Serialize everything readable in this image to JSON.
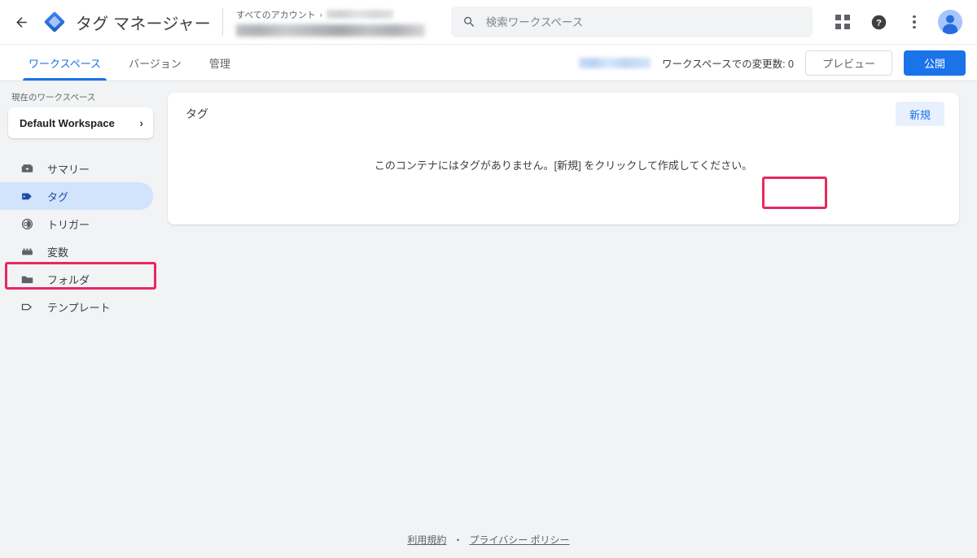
{
  "topbar": {
    "back_icon": "back-arrow-icon",
    "logo_icon": "tag-manager-logo-icon",
    "title": "タグ マネージャー",
    "breadcrumb": {
      "all_accounts": "すべてのアカウント",
      "separator": "›",
      "account_name_redacted": "",
      "container_name_redacted": ""
    },
    "search": {
      "icon": "search-icon",
      "placeholder": "検索ワークスペース",
      "value": ""
    },
    "apps_icon": "apps-grid-icon",
    "help_icon": "help-circle-icon",
    "more_icon": "more-vertical-icon",
    "avatar_icon": "account-avatar-icon"
  },
  "tabbar": {
    "tabs": [
      {
        "label": "ワークスペース",
        "active": true
      },
      {
        "label": "バージョン",
        "active": false
      },
      {
        "label": "管理",
        "active": false
      }
    ],
    "container_badge_redacted": "",
    "changes_text": "ワークスペースでの変更数: 0",
    "preview_label": "プレビュー",
    "publish_label": "公開"
  },
  "sidebar": {
    "workspace_label": "現在のワークスペース",
    "workspace_name": "Default Workspace",
    "workspace_chevron": "›",
    "items": [
      {
        "label": "サマリー",
        "icon": "summary-icon",
        "active": false
      },
      {
        "label": "タグ",
        "icon": "tag-icon",
        "active": true
      },
      {
        "label": "トリガー",
        "icon": "trigger-icon",
        "active": false
      },
      {
        "label": "変数",
        "icon": "variables-icon",
        "active": false
      },
      {
        "label": "フォルダ",
        "icon": "folder-icon",
        "active": false
      },
      {
        "label": "テンプレート",
        "icon": "template-icon",
        "active": false
      }
    ]
  },
  "main": {
    "card_title": "タグ",
    "new_button_label": "新規",
    "empty_message": "このコンテナにはタグがありません。[新規] をクリックして作成してください。"
  },
  "footer": {
    "terms_label": "利用規約",
    "separator": "・",
    "privacy_label": "プライバシー ポリシー"
  },
  "annotations": {
    "color": "#e8285f",
    "targets": [
      "sidebar-item-tag",
      "new-tag-button"
    ]
  },
  "colors": {
    "accent_blue": "#1a73e8",
    "active_nav_bg": "#d2e3fc",
    "page_bg": "#f1f3f4",
    "annotation_pink": "#e8285f"
  }
}
